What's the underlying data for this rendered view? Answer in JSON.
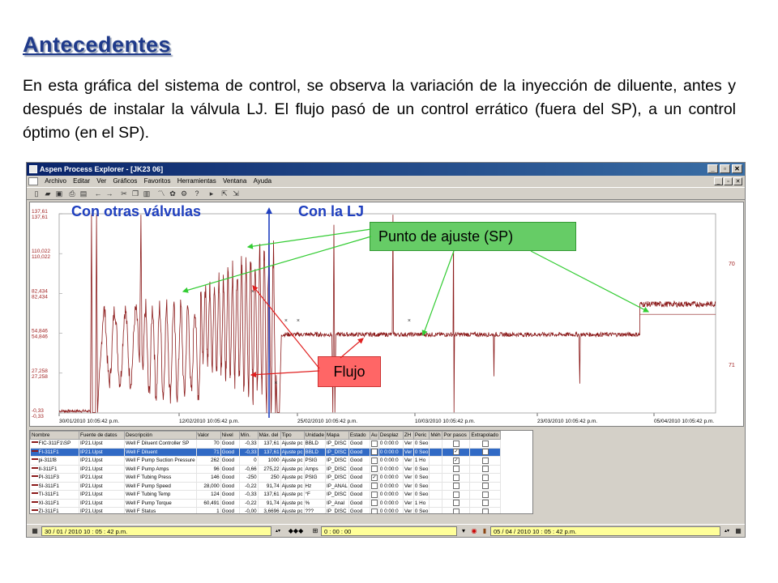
{
  "slide": {
    "title": "Antecedentes",
    "body": "En esta gráfica del sistema de control, se observa la variación de la inyección de diluente, antes y después de instalar la válvula  LJ. El flujo pasó de un control errático (fuera del SP), a un control óptimo (en el SP)."
  },
  "window": {
    "title": "Aspen Process Explorer - [JK23 06]",
    "menu": [
      "Archivo",
      "Editar",
      "Ver",
      "Gráficos",
      "Favoritos",
      "Herramientas",
      "Ventana",
      "Ayuda"
    ]
  },
  "plot": {
    "y_ticks_left": [
      {
        "a": "137,61",
        "b": "137,61"
      },
      {
        "a": "110,022",
        "b": "110,022"
      },
      {
        "a": "82,434",
        "b": "82,434"
      },
      {
        "a": "54,846",
        "b": "54,846"
      },
      {
        "a": "27,258",
        "b": "27,258"
      },
      {
        "a": "-0,33",
        "b": "-0,33"
      }
    ],
    "y_ticks_right": [
      "70",
      "71"
    ],
    "x_ticks": [
      "30/01/2010  10:05:42 p.m.",
      "12/02/2010  10:05:42 p.m.",
      "25/02/2010  10:05:42 p.m.",
      "10/03/2010  10:05:42 p.m.",
      "23/03/2010  10:05:42 p.m.",
      "05/04/2010  10:05:42 p.m."
    ],
    "colors": {
      "trace": "#8b1a1a",
      "sp_callout": "#66cc66",
      "flujo_callout": "#ff6666",
      "annotation_blue": "#1f3fbf"
    }
  },
  "annotations": {
    "con_otras": "Con otras válvulas",
    "con_lj": "Con la LJ",
    "punto_ajuste": "Punto de ajuste (SP)",
    "flujo": "Flujo"
  },
  "table": {
    "headers": [
      "Nombre",
      "Fuente de datos",
      "Descripción",
      "Valor",
      "Nivel",
      "Mín.",
      "Máx. del",
      "Tipo",
      "Unidade",
      "Mapa",
      "Estado",
      "Au",
      "Desplaz",
      "ZH",
      "Peric",
      "Méh",
      "Por pasos",
      "Extrapolado"
    ],
    "rows": [
      [
        "FIC-311F1\\SP",
        "IP21.Upst",
        "Well F Diluent Controller SP",
        "70",
        "Good",
        "-0,33",
        "137,61",
        "Ajuste pc",
        "BBLD",
        "IP_DISC",
        "Good",
        "",
        "0  0:00:0",
        "Ver",
        "0 Seo",
        "",
        "",
        ""
      ],
      [
        "FI-311F1",
        "IP21.Upst",
        "Well F Diluent",
        "71",
        "Good",
        "-0,33",
        "137,61",
        "Ajuste pc",
        "BBLD",
        "IP_DISC",
        "Good",
        "",
        "0  0:00:0",
        "Ver",
        "0 Seo",
        "",
        "",
        ""
      ],
      [
        "pi-311f8",
        "IP21.Upst",
        "Well F Pump Suction Pressure",
        "262",
        "Good",
        "0",
        "1000",
        "Ajuste pc",
        "PSIG",
        "IP_DISC",
        "Good",
        "",
        "0  0:00:0",
        "Ver",
        "1 Ho",
        "",
        "",
        ""
      ],
      [
        "II-311F1",
        "IP21.Upst",
        "Well F Pump Amps",
        "96",
        "Good",
        "-0,66",
        "275,22",
        "Ajuste pc",
        "Amps",
        "IP_DISC",
        "Good",
        "",
        "0  0:00:0",
        "Ver",
        "0 Seo",
        "",
        "",
        ""
      ],
      [
        "PI-311F3",
        "IP21.Upst",
        "Well F Tubing Press",
        "146",
        "Good",
        "-250",
        "250",
        "Ajuste pc",
        "PSIG",
        "IP_DISC",
        "Good",
        "",
        "0  0:00:0",
        "Ver",
        "0 Seo",
        "",
        "",
        ""
      ],
      [
        "SI-311F1",
        "IP21.Upst",
        "Well F Pump Speed",
        "28,000",
        "Good",
        "-0,22",
        "91,74",
        "Ajuste pc",
        "Hz",
        "IP_ANAL",
        "Good",
        "",
        "0  0:00:0",
        "Ver",
        "0 Seo",
        "",
        "",
        ""
      ],
      [
        "TI-311F1",
        "IP21.Upst",
        "Well F Tubing Temp",
        "124",
        "Good",
        "-0,33",
        "137,61",
        "Ajuste pc",
        "°F",
        "IP_DISC",
        "Good",
        "",
        "0  0:00:0",
        "Ver",
        "0 Seo",
        "",
        "",
        ""
      ],
      [
        "XI-311F1",
        "IP21.Upst",
        "Well F Pump Torque",
        "60,491",
        "Good",
        "-0,22",
        "91,74",
        "Ajuste pc",
        "%",
        "IP_Anal",
        "Good",
        "",
        "0  0:00:0",
        "Ver",
        "1 Ho",
        "",
        "",
        ""
      ],
      [
        "ZI-311F1",
        "IP21.Upst",
        "Well F Status",
        "1",
        "Good",
        "-0,00",
        "3,6696",
        "Ajuste pc",
        "???",
        "IP_DISC",
        "Good",
        "",
        "0  0:00:0",
        "Ver",
        "0 Seo",
        "",
        "",
        ""
      ]
    ],
    "au_checked": [
      false,
      false,
      false,
      false,
      true,
      false,
      false,
      false,
      false
    ],
    "pasos_checked": [
      false,
      true,
      true,
      false,
      false,
      false,
      false,
      false,
      false
    ],
    "selected_row": 1
  },
  "bottom": {
    "start_time": "30 / 01 / 2010    10 : 05 : 42  p.m.",
    "duration": "0 : 00 : 00",
    "end_time": "05 / 04 / 2010    10 : 05 : 42  p.m."
  }
}
